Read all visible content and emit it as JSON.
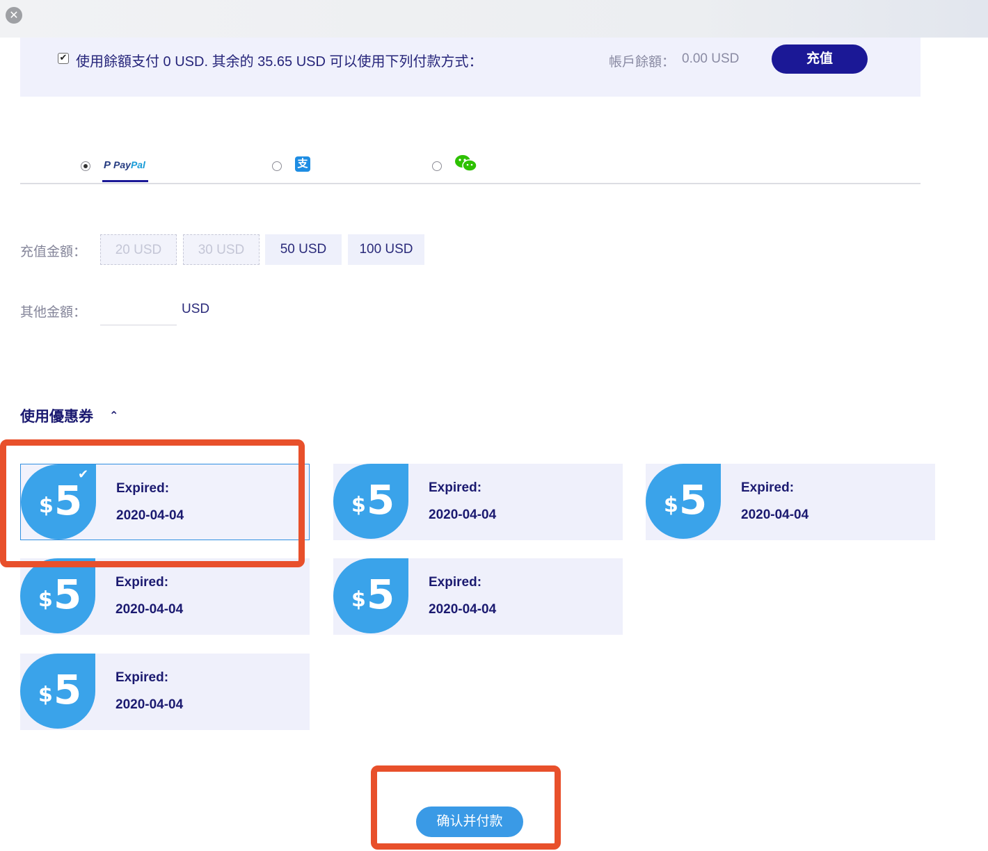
{
  "window": {
    "close_icon": "x-icon"
  },
  "balance": {
    "checkbox_checked": true,
    "text": "使用餘額支付 0 USD. 其余的 35.65 USD 可以使用下列付款方式：",
    "account_label": "帳戶餘額：",
    "account_value": "0.00 USD",
    "recharge_label": "充值"
  },
  "payment_methods": [
    {
      "id": "paypal",
      "selected": true,
      "logo_part1": "Pay",
      "logo_part2": "Pal",
      "icon": "paypal-icon"
    },
    {
      "id": "alipay",
      "selected": false,
      "glyph": "支",
      "icon": "alipay-icon"
    },
    {
      "id": "wechat",
      "selected": false,
      "icon": "wechat-pay-icon"
    }
  ],
  "recharge_amount": {
    "label": "充值金額：",
    "options": [
      {
        "label": "20 USD",
        "disabled": true
      },
      {
        "label": "30 USD",
        "disabled": true
      },
      {
        "label": "50 USD",
        "disabled": false
      },
      {
        "label": "100 USD",
        "disabled": false
      }
    ]
  },
  "other_amount": {
    "label": "其他金額：",
    "value": "",
    "unit": "USD"
  },
  "coupons": {
    "title": "使用優惠券",
    "chevron_icon": "chevron-up-icon",
    "items": [
      {
        "currency": "$",
        "amount": "5",
        "expired_label": "Expired:",
        "expired_date": "2020-04-04",
        "selected": true
      },
      {
        "currency": "$",
        "amount": "5",
        "expired_label": "Expired:",
        "expired_date": "2020-04-04",
        "selected": false
      },
      {
        "currency": "$",
        "amount": "5",
        "expired_label": "Expired:",
        "expired_date": "2020-04-04",
        "selected": false
      },
      {
        "currency": "$",
        "amount": "5",
        "expired_label": "Expired:",
        "expired_date": "2020-04-04",
        "selected": false
      },
      {
        "currency": "$",
        "amount": "5",
        "expired_label": "Expired:",
        "expired_date": "2020-04-04",
        "selected": false
      },
      {
        "currency": "$",
        "amount": "5",
        "expired_label": "Expired:",
        "expired_date": "2020-04-04",
        "selected": false
      }
    ]
  },
  "confirm": {
    "label": "确认并付款"
  },
  "colors": {
    "accent": "#1b1896",
    "coupon_blue": "#3aa3ea",
    "highlight": "#e8502b",
    "confirm": "#3a9ae6"
  }
}
